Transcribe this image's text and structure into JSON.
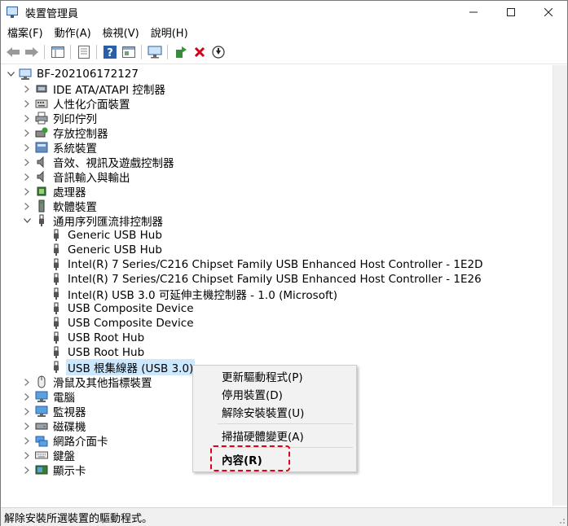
{
  "window": {
    "title": "裝置管理員"
  },
  "menu": [
    "檔案(F)",
    "動作(A)",
    "檢視(V)",
    "說明(H)"
  ],
  "tree": {
    "root": "BF-202106172127",
    "categories": [
      {
        "label": "IDE ATA/ATAPI 控制器",
        "icon": "ide-controller-icon"
      },
      {
        "label": "人性化介面裝置",
        "icon": "hid-icon"
      },
      {
        "label": "列印佇列",
        "icon": "printer-icon"
      },
      {
        "label": "存放控制器",
        "icon": "storage-controller-icon"
      },
      {
        "label": "系統裝置",
        "icon": "system-device-icon"
      },
      {
        "label": "音效、視訊及遊戲控制器",
        "icon": "speaker-icon"
      },
      {
        "label": "音訊輸入與輸出",
        "icon": "speaker-icon"
      },
      {
        "label": "處理器",
        "icon": "processor-icon"
      },
      {
        "label": "軟體裝置",
        "icon": "software-device-icon"
      },
      {
        "label": "通用序列匯流排控制器",
        "icon": "usb-icon",
        "expanded": true
      }
    ],
    "usb_children": [
      "Generic USB Hub",
      "Generic USB Hub",
      "Intel(R) 7 Series/C216 Chipset Family USB Enhanced Host Controller - 1E2D",
      "Intel(R) 7 Series/C216 Chipset Family USB Enhanced Host Controller - 1E26",
      "Intel(R) USB 3.0 可延伸主機控制器 - 1.0 (Microsoft)",
      "USB Composite Device",
      "USB Composite Device",
      "USB Root Hub",
      "USB Root Hub",
      "USB 根集線器 (USB 3.0)"
    ],
    "after": [
      {
        "label": "滑鼠及其他指標裝置",
        "icon": "mouse-icon"
      },
      {
        "label": "電腦",
        "icon": "computer-icon"
      },
      {
        "label": "監視器",
        "icon": "monitor-icon"
      },
      {
        "label": "磁碟機",
        "icon": "disk-drive-icon"
      },
      {
        "label": "網路介面卡",
        "icon": "network-adapter-icon"
      },
      {
        "label": "鍵盤",
        "icon": "keyboard-icon"
      },
      {
        "label": "顯示卡",
        "icon": "display-adapter-icon"
      }
    ]
  },
  "context_menu": {
    "update_driver": "更新驅動程式(P)",
    "disable_device": "停用裝置(D)",
    "uninstall_device": "解除安裝裝置(U)",
    "scan_hardware": "掃描硬體變更(A)",
    "properties": "內容(R)"
  },
  "status": "解除安裝所選裝置的驅動程式。",
  "colors": {
    "selection": "#cce8ff",
    "highlight_border": "#e0001a",
    "accent": "#2b5ea8"
  }
}
